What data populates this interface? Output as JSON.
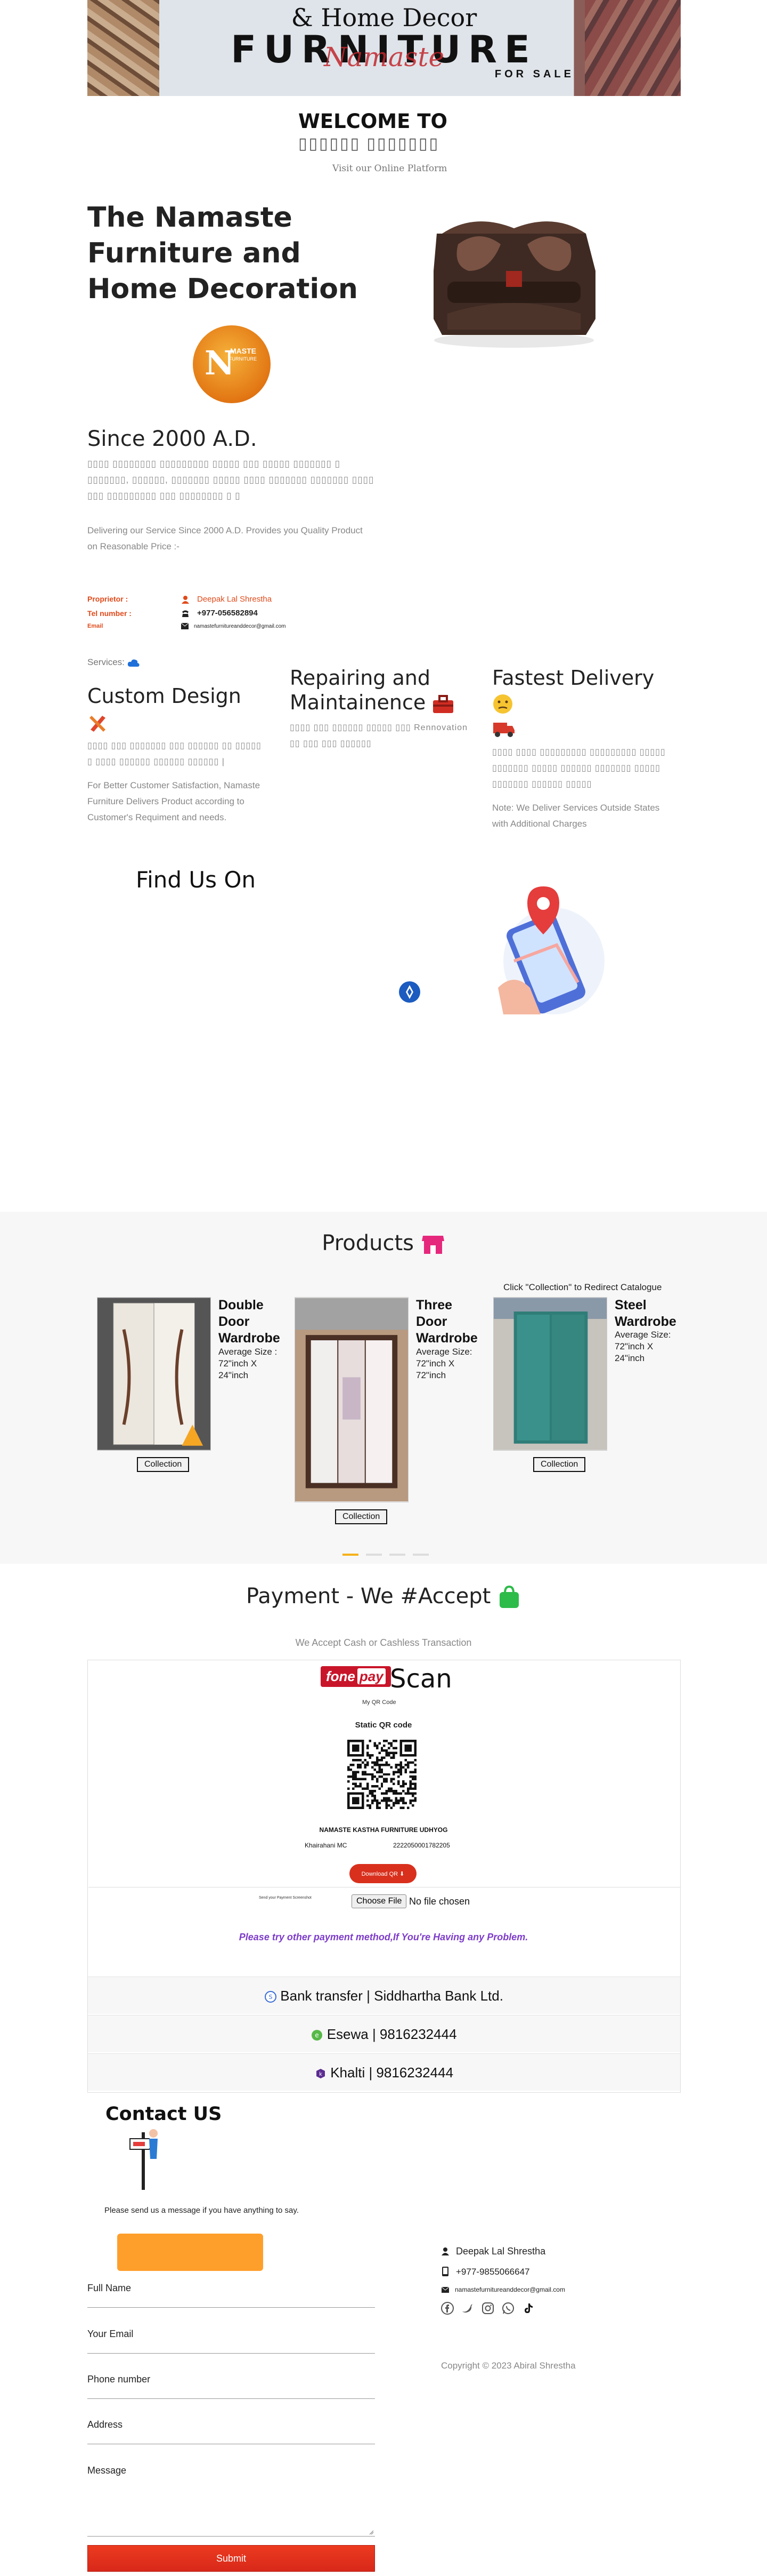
{
  "banner": {
    "line1": "& Home Decor",
    "line2": "FURNITURE",
    "line3": "Namaste",
    "line4": "FOR SALE"
  },
  "welcome": {
    "title": "WELCOME TO",
    "subtitle": "▯▯▯▯▯▯ ▯▯▯▯▯▯▯",
    "visit": "Visit our Online Platform"
  },
  "hero": {
    "title": "The Namaste Furniture and Home Decoration",
    "logo_letter": "N",
    "logo_word": "MASTE",
    "logo_word2": "FURNITURE"
  },
  "about": {
    "since": "Since 2000 A.D.",
    "para_hi": "▯▯▯▯ ▯▯▯▯▯▯▯▯ ▯▯▯▯▯▯▯▯▯ ▯▯▯▯▯ ▯▯▯ ▯▯▯▯▯ ▯▯▯▯▯▯▯ ▯ ▯▯▯▯▯▯▯, ▯▯▯▯▯▯, ▯▯▯▯▯▯▯ ▯▯▯▯▯ ▯▯▯▯ ▯▯▯▯▯▯▯ ▯▯▯▯▯▯▯ ▯▯▯▯ ▯▯▯ ▯▯▯▯▯▯▯▯▯ ▯▯▯ ▯▯▯▯▯▯▯▯ ▯ ▯",
    "para_en": "Delivering our Service Since 2000 A.D. Provides you Quality Product on Reasonable Price :-"
  },
  "proprietor": {
    "label_proprietor": "Proprietor :",
    "label_tel": "Tel number :",
    "label_email": "Email",
    "name": "Deepak Lal Shrestha",
    "tel": "+977-056582894",
    "email": "namastefurnitureanddecor@gmail.com"
  },
  "services": {
    "label": "Services:",
    "items": [
      {
        "title": "Custom Design",
        "hi": "▯▯▯▯ ▯▯▯ ▯▯▯▯▯▯▯ ▯▯▯ ▯▯▯▯▯▯ ▯▯ ▯▯▯▯▯ ▯ ▯▯▯▯ ▯▯▯▯▯▯ ▯▯▯▯▯▯ ▯▯▯▯▯▯ |",
        "en": "For Better Customer Satisfaction, Namaste Furniture Delivers Product according to Customer's Requiment and needs."
      },
      {
        "title": "Repairing and Maintainence",
        "hi": "▯▯▯▯ ▯▯▯ ▯▯▯▯▯▯ ▯▯▯▯▯ ▯▯▯ Rennovation ▯▯ ▯▯▯ ▯▯▯ ▯▯▯▯▯▯",
        "en": ""
      },
      {
        "title": "Fastest Delivery",
        "hi": "▯▯▯▯ ▯▯▯▯ ▯▯▯▯▯▯▯▯▯ ▯▯▯▯▯▯▯▯▯ ▯▯▯▯▯ ▯▯▯▯▯▯▯ ▯▯▯▯▯ ▯▯▯▯▯▯ ▯▯▯▯▯▯▯ ▯▯▯▯▯ ▯▯▯▯▯▯▯ ▯▯▯▯▯▯ ▯▯▯▯▯",
        "en": "Note: We Deliver Services Outside States with Additional Charges"
      }
    ]
  },
  "find_us": "Find Us On",
  "products": {
    "title": "Products",
    "note": "Click \"Collection\" to Redirect Catalogue",
    "button_label": "Collection",
    "items": [
      {
        "name": "Double Door Wardrobe",
        "size": "Average Size : 72\"inch X 24\"inch"
      },
      {
        "name": "Three Door Wardrobe",
        "size": "Average Size: 72\"inch X 72\"inch"
      },
      {
        "name": "Steel Wardrobe",
        "size": "Average Size: 72\"inch X 24\"inch"
      }
    ]
  },
  "payment": {
    "title": "Payment - We #Accept",
    "subtitle": "We Accept Cash or Cashless Transaction",
    "fone": "fone",
    "pay": "pay",
    "scan": "Scan",
    "my_qr": "My QR Code",
    "static_qr": "Static QR code",
    "merchant": "NAMASTE KASTHA FURNITURE UDHYOG",
    "location": "Khairahani MC",
    "code": "2222050001782205",
    "download": "Download QR",
    "upload_label": "Send your Payment Screenshot",
    "choose_file": "Choose File",
    "no_file": "No file chosen",
    "alt_note": "Please try other payment method,If You're Having any Problem.",
    "bank": "Bank transfer | Siddhartha Bank Ltd.",
    "esewa": "Esewa | 9816232444",
    "khalti": "Khalti | 9816232444"
  },
  "contact": {
    "title": "Contact US",
    "message": "Please send us a message if you have anything to say.",
    "fields": {
      "name": "Full Name",
      "email": "Your Email",
      "phone": "Phone number",
      "address": "Address",
      "message": "Message"
    },
    "submit": "Submit",
    "footer_name": "Deepak Lal Shrestha",
    "footer_tel": "+977-9855066647",
    "footer_email": "namastefurnitureanddecor@gmail.com",
    "copyright": "Copyright © 2023 Abiral Shrestha"
  },
  "colors": {
    "accent": "#e04a1a",
    "submit": "#e2301d",
    "orange": "#ff9f2b"
  }
}
